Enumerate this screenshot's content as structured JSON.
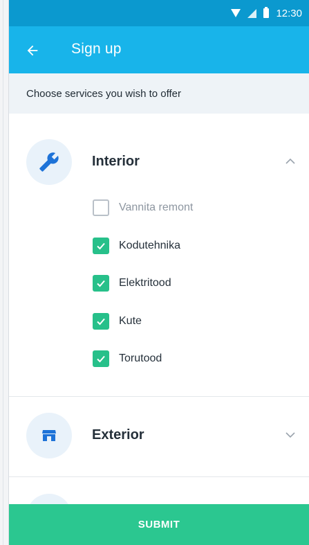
{
  "status_bar": {
    "time": "12:30",
    "icons": [
      "wifi-icon",
      "signal-icon",
      "battery-icon"
    ],
    "color": "#0b99cf"
  },
  "app_bar": {
    "title": "Sign up",
    "back_icon": "arrow-left-icon",
    "color": "#18b4ea"
  },
  "sub_header": {
    "text": "Choose services you wish to offer"
  },
  "categories": [
    {
      "title": "Interior",
      "icon": "wrench-icon",
      "expanded": true,
      "chevron_icon": "chevron-up-icon",
      "items": [
        {
          "label": "Vannita remont",
          "checked": false
        },
        {
          "label": "Kodutehnika",
          "checked": true
        },
        {
          "label": "Elektritood",
          "checked": true
        },
        {
          "label": "Kute",
          "checked": true
        },
        {
          "label": "Torutood",
          "checked": true
        }
      ]
    },
    {
      "title": "Exterior",
      "icon": "storefront-icon",
      "expanded": false,
      "chevron_icon": "chevron-down-icon",
      "items": []
    }
  ],
  "submit": {
    "label": "SUBMIT",
    "color": "#2bc790"
  },
  "accent_colors": {
    "checkbox_checked": "#27c08a",
    "icon_blue": "#1e73d8"
  }
}
